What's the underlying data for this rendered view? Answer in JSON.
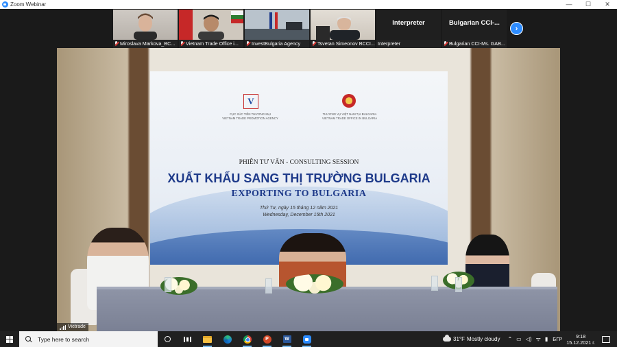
{
  "window": {
    "title": "Zoom Webinar",
    "controls": [
      "—",
      "☐",
      "✕"
    ]
  },
  "gallery": {
    "participants": [
      {
        "name": "Miroslava Markova_BC...",
        "muted": true,
        "has_video": true
      },
      {
        "name": "Vietnam Trade Office i...",
        "muted": true,
        "has_video": true
      },
      {
        "name": "InvestBulgaria Agency",
        "muted": true,
        "has_video": true
      },
      {
        "name": "Tsvetan Simeonov BCCI...",
        "muted": true,
        "has_video": true
      },
      {
        "name": "Interpreter",
        "muted": false,
        "has_video": false,
        "display": "Interpreter"
      },
      {
        "name": "Bulgarian CCI-Ms. GAB...",
        "muted": true,
        "has_video": false,
        "display": "Bulgarian CCI-..."
      }
    ],
    "next_icon": "chevron-right-icon"
  },
  "main_video": {
    "speaker_label": "Vietrade",
    "slide": {
      "agency_left": [
        "CỤC XÚC TIẾN THƯƠNG MẠI",
        "VIETNAM TRADE PROMOTION AGENCY"
      ],
      "agency_right": [
        "THƯƠNG VỤ VIỆT NAM TẠI BULGARIA",
        "VIETNAM TRADE OFFICE IN BULGARIA"
      ],
      "logo_text": "V",
      "session": "PHIÊN TƯ VẤN - CONSULTING SESSION",
      "title": "XUẤT KHẨU SANG THỊ TRƯỜNG BULGARIA",
      "subtitle": "EXPORTING TO BULGARIA",
      "date_vi": "Thứ Tư, ngày 15 tháng 12 năm 2021",
      "date_en": "Wednesday, December 15th 2021"
    }
  },
  "taskbar": {
    "search_placeholder": "Type here to search",
    "weather": {
      "temp": "31°F",
      "condition": "Mostly cloudy"
    },
    "language": "БГР",
    "time": "9:18",
    "date": "15.12.2021 г.",
    "ppt_letter": "P",
    "word_letter": "W"
  },
  "colors": {
    "zoom_blue": "#2d8cff",
    "slide_title": "#1e3a8a",
    "taskbar": "#202020"
  }
}
